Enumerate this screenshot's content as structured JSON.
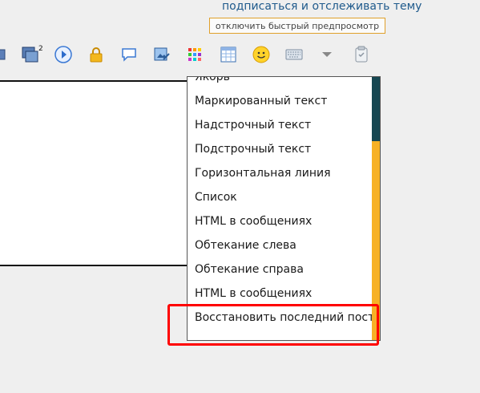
{
  "header": {
    "subscribe_link": "подписаться и отслеживать тему",
    "preview_button": "отключить быстрый предпросмотр"
  },
  "toolbar": {
    "icons": [
      "partial-icon",
      "copy-windows-icon",
      "play-icon",
      "lock-icon",
      "speech-bubble-icon",
      "image-edit-icon",
      "color-grid-icon",
      "table-icon",
      "smiley-icon",
      "keyboard-icon",
      "dropdown-arrow-icon",
      "clipboard-icon"
    ],
    "copy_superscript": "2"
  },
  "dropdown_menu": {
    "items": [
      "Якорь",
      "Маркированный текст",
      "Надстрочный текст",
      "Подстрочный текст",
      "Горизонтальная линия",
      "Список",
      "HTML в сообщениях",
      "Обтекание слева",
      "Обтекание справа",
      "HTML в сообщениях",
      "Восстановить последний пост"
    ]
  },
  "colors": {
    "highlight": "#ff0000",
    "scrollbar_track": "#f7b125",
    "scrollbar_thumb": "#174752",
    "link": "#1f5a8c"
  }
}
